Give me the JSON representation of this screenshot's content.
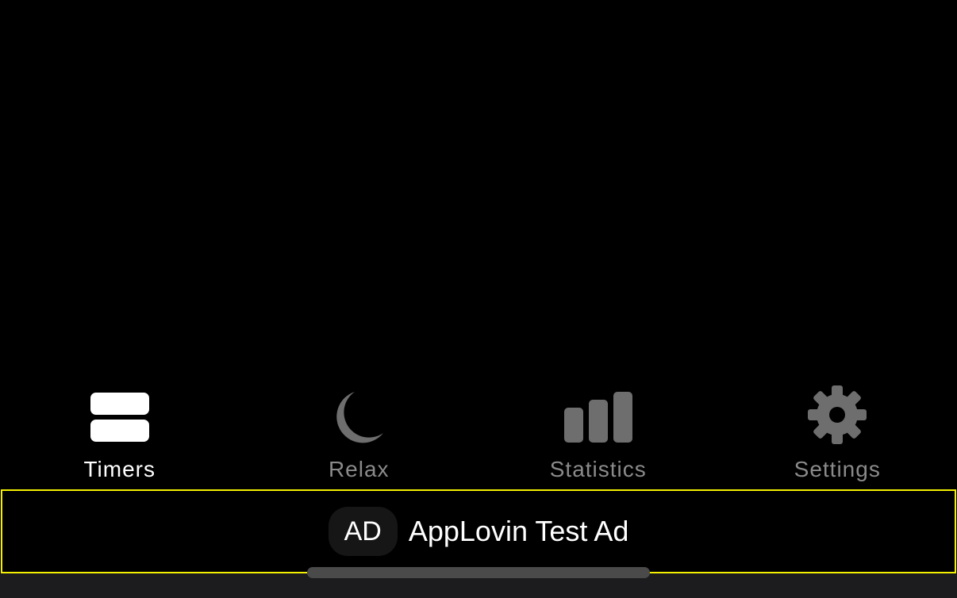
{
  "tabs": [
    {
      "label": "Timers",
      "icon": "timers-icon",
      "active": true
    },
    {
      "label": "Relax",
      "icon": "moon-icon",
      "active": false
    },
    {
      "label": "Statistics",
      "icon": "bar-chart-icon",
      "active": false
    },
    {
      "label": "Settings",
      "icon": "gear-icon",
      "active": false
    }
  ],
  "ad": {
    "badge": "AD",
    "text": "AppLovin Test Ad"
  },
  "colors": {
    "active": "#ffffff",
    "inactive": "#6e6e6e",
    "ad_border": "#f4f000",
    "background": "#000000"
  }
}
